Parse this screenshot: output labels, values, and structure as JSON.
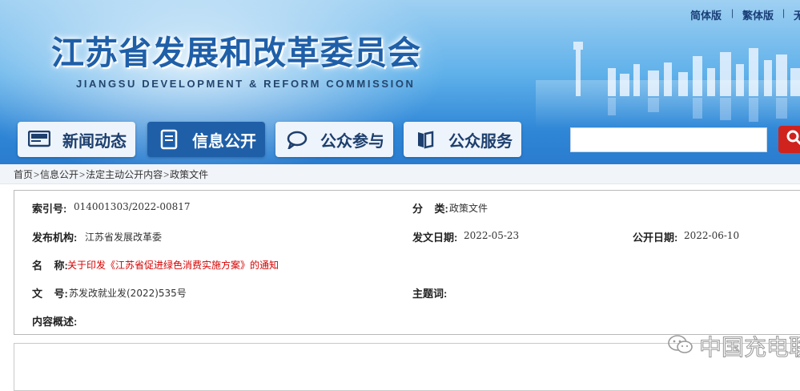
{
  "site": {
    "title": "江苏省发展和改革委员会",
    "subtitle": "JIANGSU DEVELOPMENT & REFORM COMMISSION"
  },
  "lang": {
    "simplified": "简体版",
    "traditional": "繁体版",
    "third": "无"
  },
  "nav": [
    {
      "label": "新闻动态",
      "icon": "news-icon"
    },
    {
      "label": "信息公开",
      "icon": "document-icon"
    },
    {
      "label": "公众参与",
      "icon": "chat-icon"
    },
    {
      "label": "公众服务",
      "icon": "book-icon"
    }
  ],
  "search": {
    "placeholder": "",
    "value": ""
  },
  "breadcrumb": [
    "首页",
    "信息公开",
    "法定主动公开内容",
    "政策文件"
  ],
  "info": {
    "index_label": "索引号:",
    "index_value": "014001303/2022-00817",
    "category_label": "分    类:",
    "category_value": "政策文件",
    "publisher_label": "发布机构:",
    "publisher_value": "江苏省发展改革委",
    "issue_date_label": "发文日期:",
    "issue_date_value": "2022-05-23",
    "public_date_label": "公开日期:",
    "public_date_value": "2022-06-10",
    "name_label": "名    称:",
    "name_value": "关于印发《江苏省促进绿色消费实施方案》的通知",
    "docno_label": "文    号:",
    "docno_value": "苏发改就业发(2022)535号",
    "subject_label": "主题词:",
    "subject_value": "",
    "summary_label": "内容概述:",
    "summary_value": ""
  },
  "watermark": {
    "text": "中国充电联"
  },
  "colors": {
    "brand_blue": "#1f5fa8",
    "title_red": "#d60000",
    "search_red": "#d0231e"
  }
}
